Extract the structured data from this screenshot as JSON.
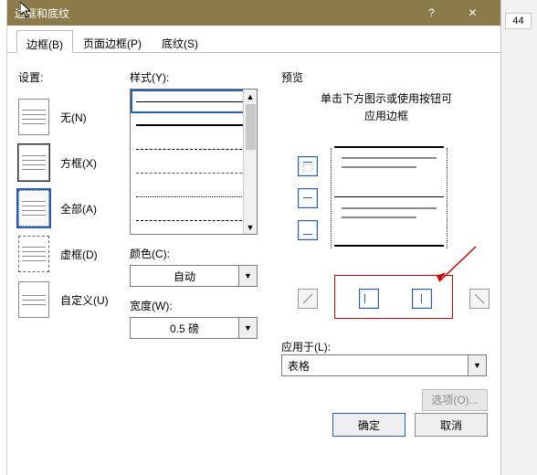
{
  "titlebar": {
    "title": "边框和底纹"
  },
  "ruler_number": "44",
  "tabs": {
    "border": "边框(B)",
    "page_border": "页面边框(P)",
    "shading": "底纹(S)"
  },
  "settings": {
    "label": "设置:",
    "none": "无(N)",
    "box": "方框(X)",
    "all": "全部(A)",
    "grid": "虚框(D)",
    "custom": "自定义(U)"
  },
  "style": {
    "label": "样式(Y):",
    "color_label": "颜色(C):",
    "color_value": "自动",
    "width_label": "宽度(W):",
    "width_value": "0.5 磅"
  },
  "preview": {
    "label": "预览",
    "hint_line1": "单击下方图示或使用按钮可",
    "hint_line2": "应用边框",
    "apply_label": "应用于(L):",
    "apply_value": "表格",
    "options": "选项(O)..."
  },
  "buttons": {
    "ok": "确定",
    "cancel": "取消"
  },
  "icons": {
    "help": "?",
    "close": "✕",
    "dropdown": "▼",
    "up": "▲",
    "down": "▼"
  }
}
